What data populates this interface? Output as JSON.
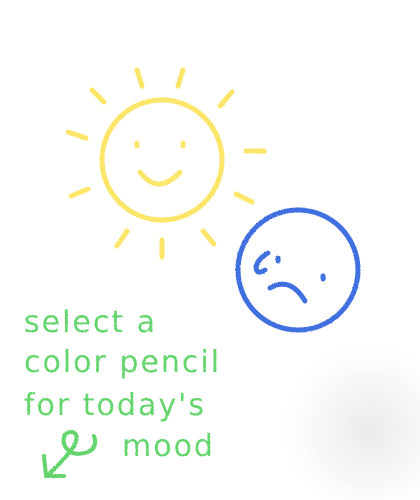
{
  "prompt": {
    "line1": "select a",
    "line2": "color pencil",
    "line3": "for today's",
    "line4": "mood"
  },
  "icons": {
    "sun": "sun-smiley-icon",
    "sad_face": "sad-face-icon",
    "arrow": "curly-arrow-icon"
  },
  "colors": {
    "sun": "#fbe66a",
    "sad_face": "#3f6fe0",
    "text": "#63d56c",
    "background": "#ffffff"
  }
}
